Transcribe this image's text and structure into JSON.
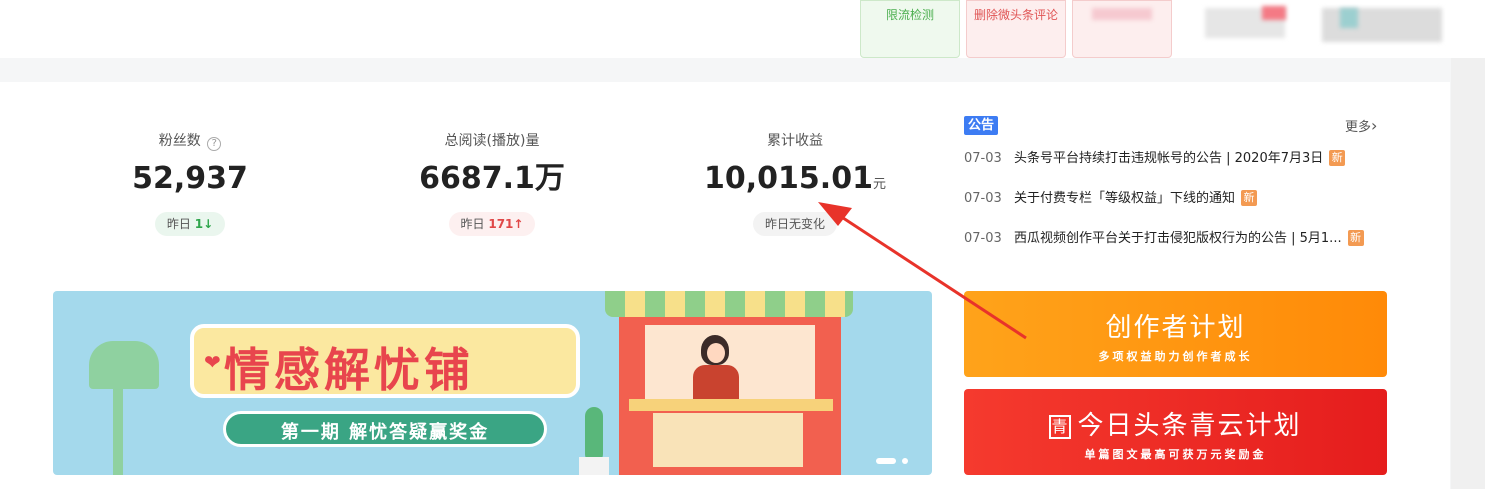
{
  "toolbar": {
    "limit_check": "限流检测",
    "delete_comment": "删除微头条评论",
    "third_tool": ""
  },
  "stats": [
    {
      "label": "粉丝数",
      "value": "52,937",
      "unit": "",
      "chip_prefix": "昨日",
      "chip_num": "1",
      "chip_dir": "↓"
    },
    {
      "label": "总阅读(播放)量",
      "value": "6687.1万",
      "unit": "",
      "chip_prefix": "昨日",
      "chip_num": "171",
      "chip_dir": "↑"
    },
    {
      "label": "累计收益",
      "value": "10,015.01",
      "unit": "元",
      "chip_prefix": "昨日无变化",
      "chip_num": "",
      "chip_dir": ""
    }
  ],
  "help_glyph": "?",
  "notice": {
    "tag": "公告",
    "more": "更多",
    "more_arrow": "›",
    "new_label": "新",
    "items": [
      {
        "date": "07-03",
        "title": "头条号平台持续打击违规帐号的公告 | 2020年7月3日"
      },
      {
        "date": "07-03",
        "title": "关于付费专栏「等级权益」下线的通知"
      },
      {
        "date": "07-03",
        "title": "西瓜视频创作平台关于打击侵犯版权行为的公告 | 5月1..."
      }
    ]
  },
  "banner": {
    "title": "情感解忧铺",
    "subtitle": "第一期 解忧答疑赢奖金",
    "heart": "❤"
  },
  "promos": [
    {
      "title": "创作者计划",
      "subtitle": "多项权益助力创作者成长"
    },
    {
      "logo": "青",
      "title": "今日头条青云计划",
      "subtitle": "单篇图文最高可获万元奖励金"
    }
  ],
  "colors": {
    "accent_blue": "#3d7cf3",
    "up_red": "#e04848",
    "down_green": "#2fa54c",
    "annotation_arrow": "#e8332a"
  }
}
